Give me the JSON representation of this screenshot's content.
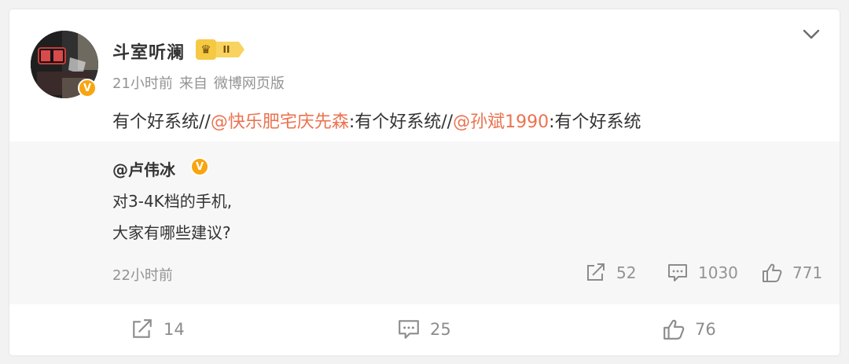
{
  "post": {
    "username": "斗室听澜",
    "rank_label": "II",
    "time": "21小时前",
    "source_prefix": "来自",
    "source": "微博网页版",
    "text_parts": {
      "part1": "有个好系统//",
      "mention1": "@快乐肥宅庆先森",
      "part2": ":有个好系统//",
      "mention2": "@孙斌1990",
      "part3": ":有个好系统"
    }
  },
  "repost": {
    "author": "@卢伟冰",
    "line1": "对3-4K档的手机,",
    "line2": "大家有哪些建议?",
    "time": "22小时前",
    "forward_count": "52",
    "comment_count": "1030",
    "like_count": "771"
  },
  "footer": {
    "forward_count": "14",
    "comment_count": "25",
    "like_count": "76"
  },
  "icons": {
    "verified": "verified-badge-icon",
    "chevron": "chevron-down-icon",
    "forward": "forward-icon",
    "comment": "comment-icon",
    "like": "like-icon"
  },
  "colors": {
    "mention": "#eb7350",
    "verified": "#f8a511",
    "meta": "#939393"
  }
}
